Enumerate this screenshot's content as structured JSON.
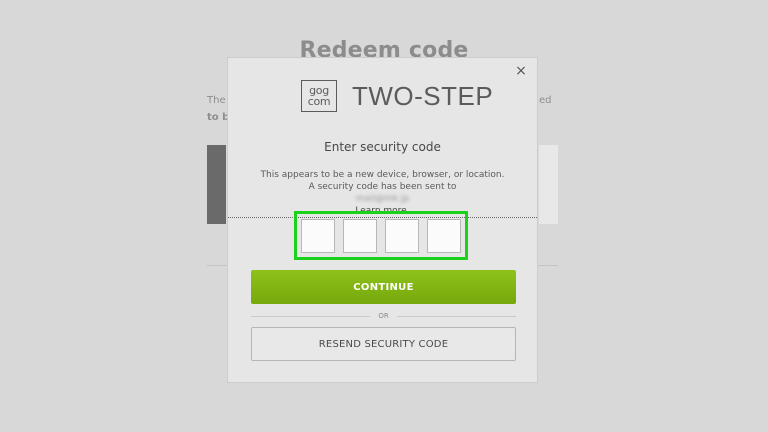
{
  "background": {
    "title": "Redeem code",
    "text_left_line1": "The",
    "text_left_line2": "to b",
    "text_right": "ed"
  },
  "modal": {
    "close_glyph": "×",
    "logo_line1": "gog",
    "logo_line2": "com",
    "brand_title": "TWO-STEP",
    "heading": "Enter security code",
    "desc_line1": "This appears to be a new device, browser, or location.",
    "desc_line2_prefix": "A security code has been sent to",
    "desc_email": "mail@mk.jp",
    "learn_more": "Learn more.",
    "code_boxes": [
      "",
      "",
      "",
      ""
    ],
    "continue_label": "CONTINUE",
    "or_label": "OR",
    "resend_label": "RESEND SECURITY CODE"
  },
  "colors": {
    "continue_green": "#8ec21a",
    "highlight_green": "#1bd11b"
  }
}
